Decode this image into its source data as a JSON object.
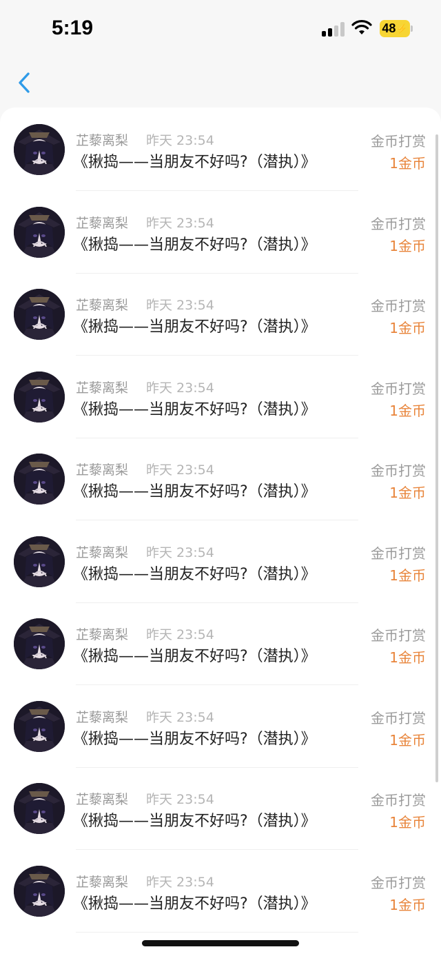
{
  "status_bar": {
    "time": "5:19",
    "battery": "48"
  },
  "nav": {
    "back_icon": "chevron-left-icon"
  },
  "colors": {
    "accent": "#2f9be8",
    "reward": "#e8843a",
    "battery": "#f7d534"
  },
  "list": {
    "items": [
      {
        "username": "芷藜离梨",
        "time": "昨天 23:54",
        "title": "《揪捣——当朋友不好吗?（潜执）》",
        "reward_type": "金币打赏",
        "reward_amount": "1金币"
      },
      {
        "username": "芷藜离梨",
        "time": "昨天 23:54",
        "title": "《揪捣——当朋友不好吗?（潜执）》",
        "reward_type": "金币打赏",
        "reward_amount": "1金币"
      },
      {
        "username": "芷藜离梨",
        "time": "昨天 23:54",
        "title": "《揪捣——当朋友不好吗?（潜执）》",
        "reward_type": "金币打赏",
        "reward_amount": "1金币"
      },
      {
        "username": "芷藜离梨",
        "time": "昨天 23:54",
        "title": "《揪捣——当朋友不好吗?（潜执）》",
        "reward_type": "金币打赏",
        "reward_amount": "1金币"
      },
      {
        "username": "芷藜离梨",
        "time": "昨天 23:54",
        "title": "《揪捣——当朋友不好吗?（潜执）》",
        "reward_type": "金币打赏",
        "reward_amount": "1金币"
      },
      {
        "username": "芷藜离梨",
        "time": "昨天 23:54",
        "title": "《揪捣——当朋友不好吗?（潜执）》",
        "reward_type": "金币打赏",
        "reward_amount": "1金币"
      },
      {
        "username": "芷藜离梨",
        "time": "昨天 23:54",
        "title": "《揪捣——当朋友不好吗?（潜执）》",
        "reward_type": "金币打赏",
        "reward_amount": "1金币"
      },
      {
        "username": "芷藜离梨",
        "time": "昨天 23:54",
        "title": "《揪捣——当朋友不好吗?（潜执）》",
        "reward_type": "金币打赏",
        "reward_amount": "1金币"
      },
      {
        "username": "芷藜离梨",
        "time": "昨天 23:54",
        "title": "《揪捣——当朋友不好吗?（潜执）》",
        "reward_type": "金币打赏",
        "reward_amount": "1金币"
      },
      {
        "username": "芷藜离梨",
        "time": "昨天 23:54",
        "title": "《揪捣——当朋友不好吗?（潜执）》",
        "reward_type": "金币打赏",
        "reward_amount": "1金币"
      }
    ]
  }
}
